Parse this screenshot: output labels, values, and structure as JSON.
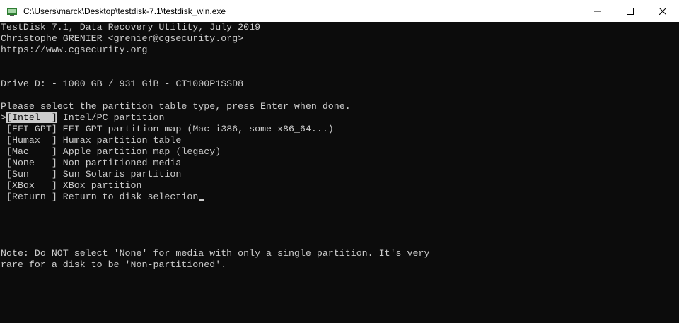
{
  "window": {
    "title": "C:\\Users\\marck\\Desktop\\testdisk-7.1\\testdisk_win.exe",
    "icon": "testdisk-app-icon",
    "controls": [
      "minimize-icon",
      "maximize-icon",
      "close-icon"
    ]
  },
  "terminal": {
    "header": [
      "TestDisk 7.1, Data Recovery Utility, July 2019",
      "Christophe GRENIER <grenier@cgsecurity.org>",
      "https://www.cgsecurity.org"
    ],
    "drive": "Drive D: - 1000 GB / 931 GiB - CT1000P1SSD8",
    "prompt": "Please select the partition table type, press Enter when done.",
    "options": [
      {
        "pointer": ">",
        "key": "[Intel  ]",
        "desc": " Intel/PC partition",
        "selected": true
      },
      {
        "pointer": " ",
        "key": "[EFI GPT]",
        "desc": " EFI GPT partition map (Mac i386, some x86_64...)",
        "selected": false
      },
      {
        "pointer": " ",
        "key": "[Humax  ]",
        "desc": " Humax partition table",
        "selected": false
      },
      {
        "pointer": " ",
        "key": "[Mac    ]",
        "desc": " Apple partition map (legacy)",
        "selected": false
      },
      {
        "pointer": " ",
        "key": "[None   ]",
        "desc": " Non partitioned media",
        "selected": false
      },
      {
        "pointer": " ",
        "key": "[Sun    ]",
        "desc": " Sun Solaris partition",
        "selected": false
      },
      {
        "pointer": " ",
        "key": "[XBox   ]",
        "desc": " XBox partition",
        "selected": false
      },
      {
        "pointer": " ",
        "key": "[Return ]",
        "desc": " Return to disk selection",
        "selected": false
      }
    ],
    "note": [
      "Note: Do NOT select 'None' for media with only a single partition. It's very",
      "rare for a disk to be 'Non-partitioned'."
    ],
    "colors": {
      "background": "#0c0c0c",
      "foreground": "#cccccc",
      "selection_bg": "#cccccc",
      "selection_fg": "#0c0c0c"
    }
  }
}
